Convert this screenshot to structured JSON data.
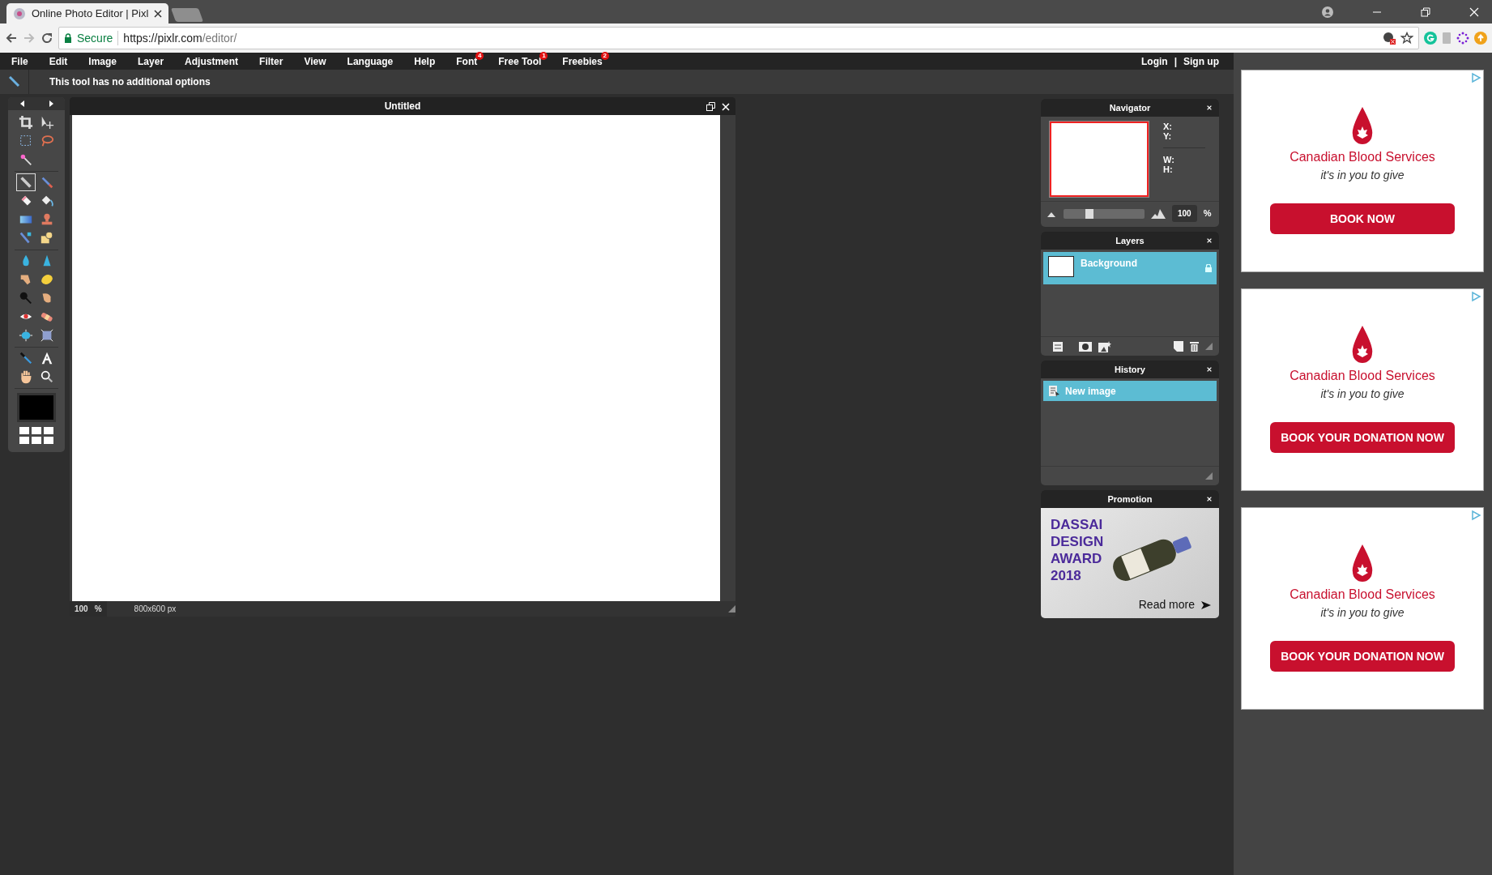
{
  "browser": {
    "tab_title": "Online Photo Editor | Pixl",
    "secure_label": "Secure",
    "url_host": "https://pixlr.com",
    "url_path": "/editor/"
  },
  "menu": [
    {
      "label": "File"
    },
    {
      "label": "Edit"
    },
    {
      "label": "Image"
    },
    {
      "label": "Layer"
    },
    {
      "label": "Adjustment"
    },
    {
      "label": "Filter"
    },
    {
      "label": "View"
    },
    {
      "label": "Language"
    },
    {
      "label": "Help"
    },
    {
      "label": "Font",
      "badge": "4"
    },
    {
      "label": "Free Tool",
      "badge": "1"
    },
    {
      "label": "Freebies",
      "badge": "2"
    }
  ],
  "account": {
    "login": "Login",
    "separator": "|",
    "signup": "Sign up"
  },
  "tool_options": "This tool has no additional options",
  "tool_groups": [
    [
      {
        "kind": "crop",
        "selected": false
      },
      {
        "kind": "move",
        "selected": false
      },
      {
        "kind": "marquee",
        "selected": false
      },
      {
        "kind": "lasso",
        "selected": false
      },
      {
        "kind": "wand",
        "selected": false
      }
    ],
    [
      {
        "kind": "pencil",
        "selected": true
      },
      {
        "kind": "brush",
        "selected": false
      },
      {
        "kind": "eraser",
        "selected": false
      },
      {
        "kind": "bucket",
        "selected": false
      },
      {
        "kind": "gradient",
        "selected": false
      },
      {
        "kind": "stamp",
        "selected": false
      },
      {
        "kind": "replace",
        "selected": false
      },
      {
        "kind": "shape",
        "selected": false
      }
    ],
    [
      {
        "kind": "blur",
        "selected": false
      },
      {
        "kind": "sharpen",
        "selected": false
      },
      {
        "kind": "smudge",
        "selected": false
      },
      {
        "kind": "sponge",
        "selected": false
      },
      {
        "kind": "burn",
        "selected": false
      },
      {
        "kind": "dodge",
        "selected": false
      },
      {
        "kind": "redeye",
        "selected": false
      },
      {
        "kind": "heal",
        "selected": false
      },
      {
        "kind": "bloat",
        "selected": false
      },
      {
        "kind": "pinch",
        "selected": false
      }
    ],
    [
      {
        "kind": "picker",
        "selected": false
      },
      {
        "kind": "type",
        "selected": false
      },
      {
        "kind": "hand",
        "selected": false
      },
      {
        "kind": "zoom",
        "selected": false
      }
    ]
  ],
  "document": {
    "title": "Untitled",
    "zoom": "100",
    "zoom_unit": "%",
    "size": "800x600 px"
  },
  "navigator": {
    "title": "Navigator",
    "coords": [
      "X:",
      "Y:"
    ],
    "dims": [
      "W:",
      "H:"
    ],
    "level": 0.3,
    "zoom": "100",
    "unit": "%"
  },
  "layers": {
    "title": "Layers",
    "items": [
      {
        "name": "Background",
        "selected": true,
        "locked": true
      }
    ]
  },
  "history": {
    "title": "History",
    "items": [
      {
        "label": "New image",
        "selected": true
      }
    ]
  },
  "promotion": {
    "title": "Promotion",
    "headline": [
      "DASSAI",
      "DESIGN",
      "AWARD",
      "2018"
    ],
    "link": "Read more"
  },
  "ads": [
    {
      "org": "Canadian Blood Services",
      "tagline": "it's in you to give",
      "button": "BOOK NOW"
    },
    {
      "org": "Canadian Blood Services",
      "tagline": "it's in you to give",
      "button": "BOOK YOUR DONATION NOW"
    },
    {
      "org": "Canadian Blood Services",
      "tagline": "it's in you to give",
      "button": "BOOK YOUR DONATION NOW"
    }
  ]
}
